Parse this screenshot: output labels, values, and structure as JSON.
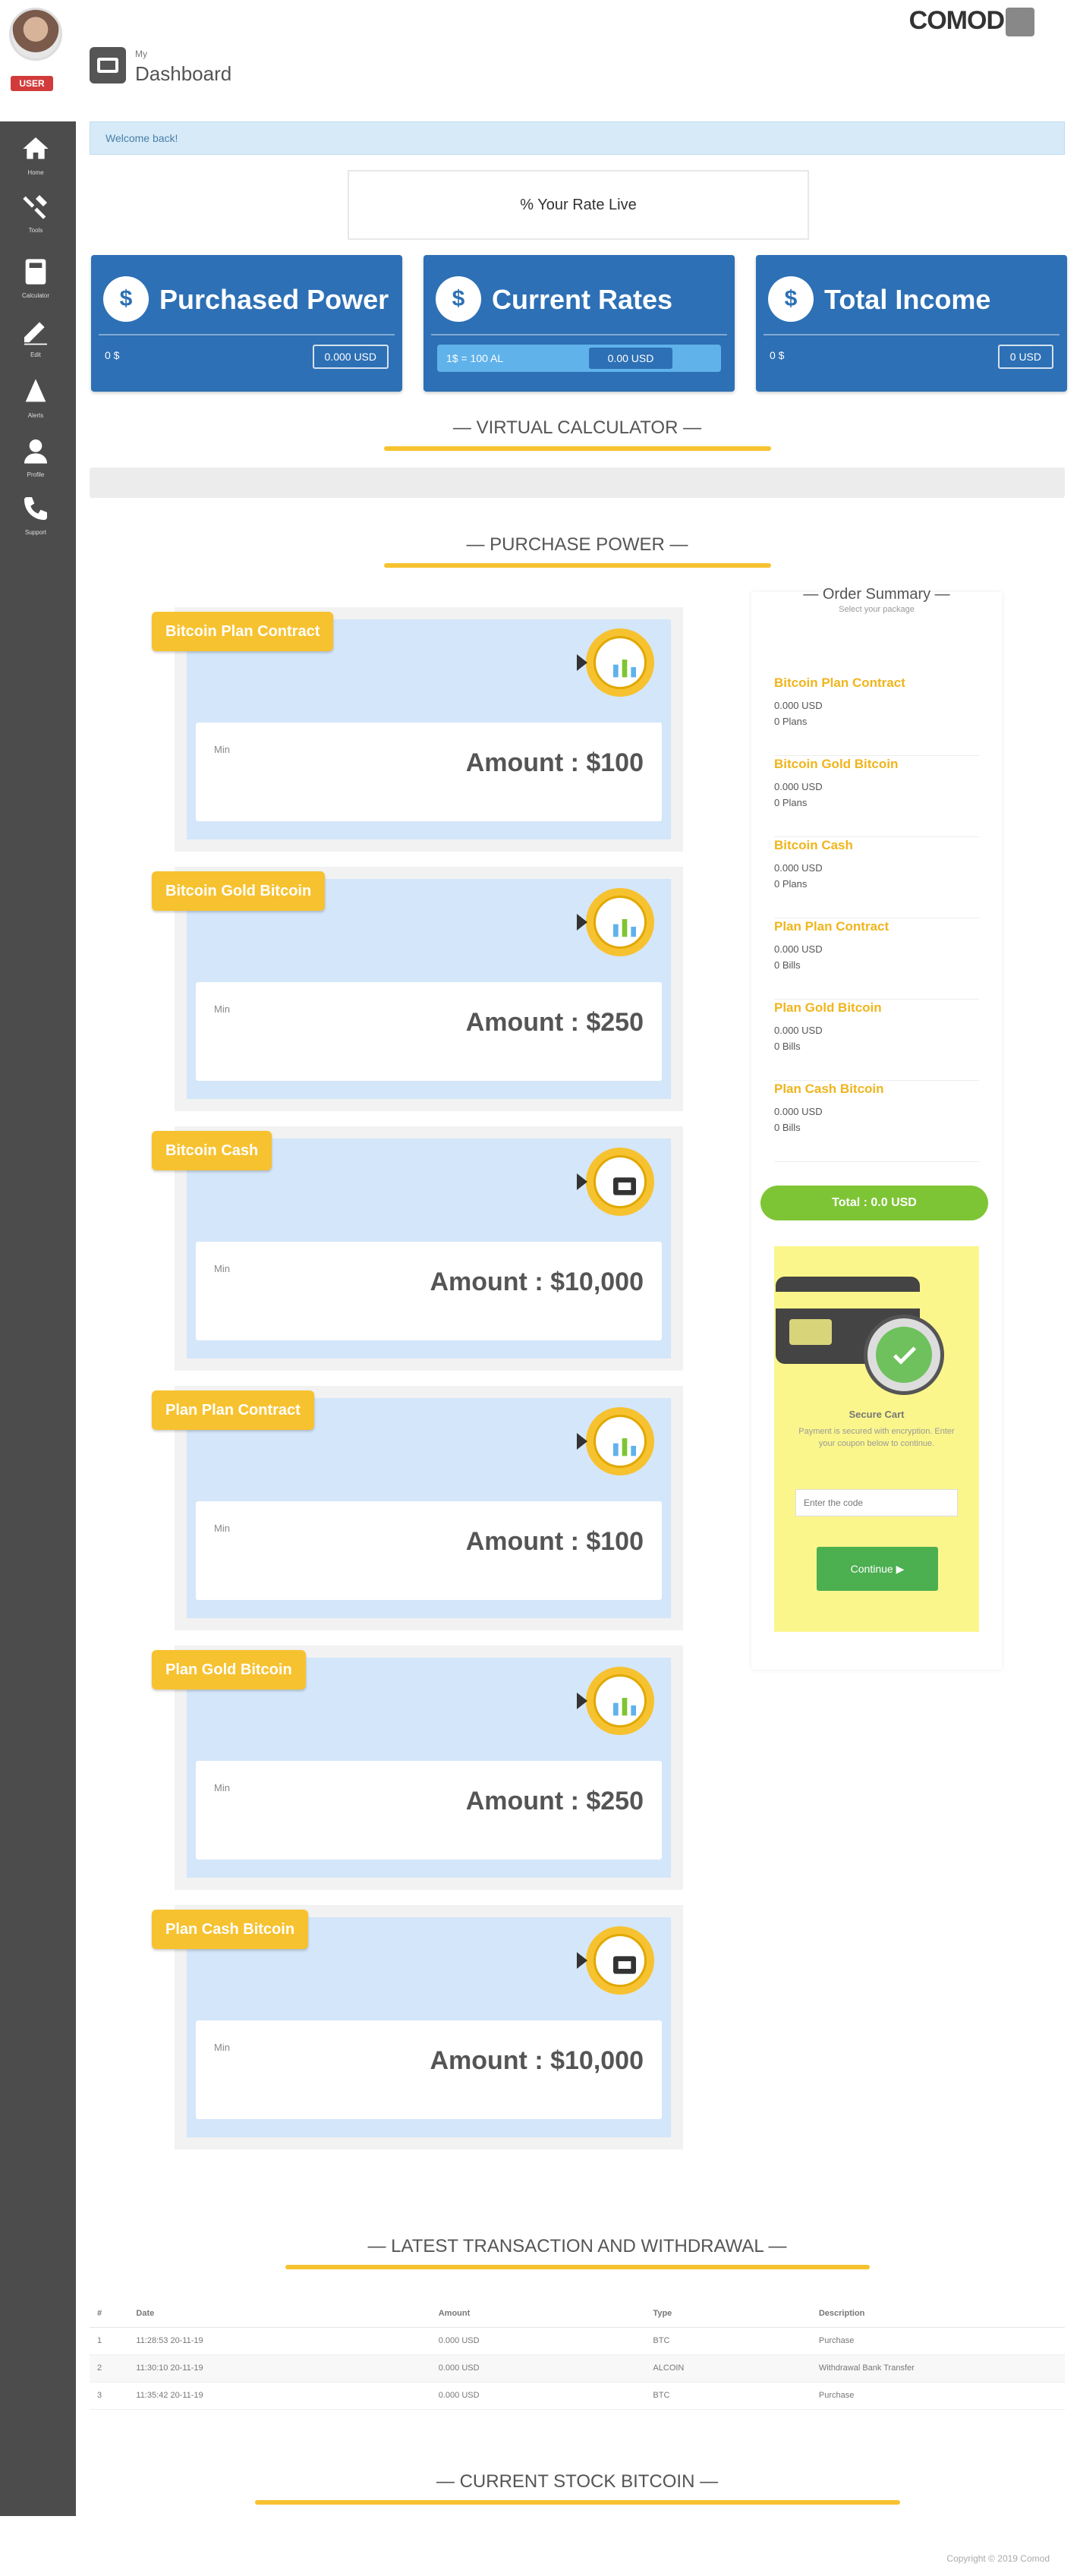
{
  "sidebar": {
    "user_badge": "USER",
    "items": [
      {
        "icon": "home-icon",
        "label": "Home"
      },
      {
        "icon": "tools-icon",
        "label": "Tools"
      },
      {
        "icon": "calculator-icon",
        "label": "Calculator"
      },
      {
        "icon": "edit-icon",
        "label": "Edit"
      },
      {
        "icon": "bell-icon",
        "label": "Alerts"
      },
      {
        "icon": "user-icon",
        "label": "Profile"
      },
      {
        "icon": "phone-icon",
        "label": "Support"
      }
    ]
  },
  "header": {
    "subtitle": "My",
    "title": "Dashboard",
    "logo": "COMOD"
  },
  "alert": {
    "text": "Welcome back!"
  },
  "rate_box": {
    "text": "% Your Rate Live"
  },
  "stats": [
    {
      "icon": "$",
      "title": "Purchased Power",
      "left": "0 $",
      "right": "0.000 USD"
    },
    {
      "icon": "$",
      "title": "Current Rates",
      "bar_text": "1$ = 100 AL",
      "chip": "0.00 USD"
    },
    {
      "icon": "$",
      "title": "Total Income",
      "left": "0 $",
      "right": "0 USD"
    }
  ],
  "sections": {
    "calculator": "— VIRTUAL CALCULATOR —",
    "purchase": "— PURCHASE POWER —",
    "transactions": "— LATEST TRANSACTION AND WITHDRAWAL —",
    "stock": "— CURRENT STOCK BITCOIN —"
  },
  "products": [
    {
      "tag": "Bitcoin Plan Contract",
      "small": "Min",
      "amount": "Amount : $100",
      "coin": "chart"
    },
    {
      "tag": "Bitcoin Gold Bitcoin",
      "small": "Min",
      "amount": "Amount : $250",
      "coin": "chart"
    },
    {
      "tag": "Bitcoin Cash",
      "small": "Min",
      "amount": "Amount : $10,000",
      "coin": "box"
    },
    {
      "tag": "Plan Plan Contract",
      "small": "Min",
      "amount": "Amount : $100",
      "coin": "chart"
    },
    {
      "tag": "Plan Gold Bitcoin",
      "small": "Min",
      "amount": "Amount : $250",
      "coin": "chart"
    },
    {
      "tag": "Plan Cash Bitcoin",
      "small": "Min",
      "amount": "Amount : $10,000",
      "coin": "box"
    }
  ],
  "summary": {
    "title": "— Order Summary —",
    "subtitle": "Select your package",
    "items": [
      {
        "name": "Bitcoin Plan Contract",
        "a": "0.000 USD",
        "b": "0 Plans"
      },
      {
        "name": "Bitcoin Gold Bitcoin",
        "a": "0.000 USD",
        "b": "0 Plans"
      },
      {
        "name": "Bitcoin Cash",
        "a": "0.000 USD",
        "b": "0 Plans"
      },
      {
        "name": "Plan Plan Contract",
        "a": "0.000 USD",
        "b": "0 Bills"
      },
      {
        "name": "Plan Gold Bitcoin",
        "a": "0.000 USD",
        "b": "0 Bills"
      },
      {
        "name": "Plan Cash Bitcoin",
        "a": "0.000 USD",
        "b": "0 Bills"
      }
    ],
    "total": "Total : 0.0 USD",
    "promo": {
      "title": "Secure Cart",
      "text": "Payment is secured with encryption. Enter your coupon below to continue.",
      "placeholder": "Enter the code",
      "button": "Continue ▶"
    }
  },
  "table": {
    "headers": [
      "#",
      "Date",
      "Amount",
      "Type",
      "Description"
    ],
    "rows": [
      [
        "1",
        "11:28:53 20-11-19",
        "0.000 USD",
        "BTC",
        "Purchase"
      ],
      [
        "2",
        "11:30:10 20-11-19",
        "0.000 USD",
        "ALCOIN",
        "Withdrawal Bank Transfer"
      ],
      [
        "3",
        "11:35:42 20-11-19",
        "0.000 USD",
        "BTC",
        "Purchase"
      ]
    ]
  },
  "footer": {
    "text": "Copyright © 2019 Comod"
  }
}
